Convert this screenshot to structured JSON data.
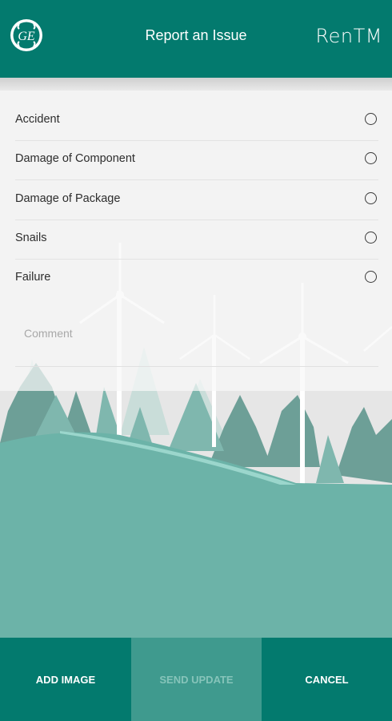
{
  "header": {
    "title": "Report an Issue",
    "brand": "RenTM",
    "logo_text": "GE",
    "background": "#037a6e"
  },
  "options": [
    {
      "label": "Accident",
      "selected": false
    },
    {
      "label": "Damage of Component",
      "selected": false
    },
    {
      "label": "Damage of Package",
      "selected": false
    },
    {
      "label": "Snails",
      "selected": false
    },
    {
      "label": "Failure",
      "selected": false
    }
  ],
  "comment": {
    "placeholder": "Comment",
    "value": ""
  },
  "footer": {
    "add_image": "ADD IMAGE",
    "send_update": "SEND UPDATE",
    "cancel": "CANCEL"
  },
  "colors": {
    "primary": "#037a6e",
    "disabled_button": "#3f9a8e",
    "hill": "#6cb3a8"
  }
}
